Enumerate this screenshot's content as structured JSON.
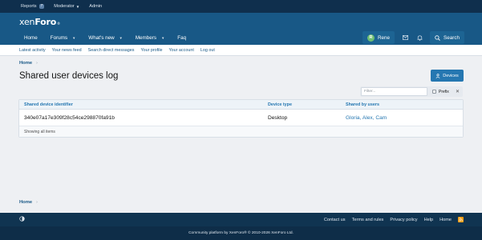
{
  "staffbar": {
    "reports_label": "Reports",
    "reports_count": "7",
    "moderator_label": "Moderator",
    "admin_label": "Admin"
  },
  "brand": {
    "logo_part1": "xen",
    "logo_part2": "Foro"
  },
  "nav": {
    "items": [
      {
        "label": "Home"
      },
      {
        "label": "Forums"
      },
      {
        "label": "What's new"
      },
      {
        "label": "Members"
      },
      {
        "label": "Faq"
      }
    ],
    "user_initial": "R",
    "user_name": "Rene",
    "search_label": "Search"
  },
  "subnav": [
    "Latest activity",
    "Your news feed",
    "Search direct messages",
    "Your profile",
    "Your account",
    "Log out"
  ],
  "breadcrumb": {
    "home": "Home"
  },
  "page": {
    "title": "Shared user devices log",
    "devices_button": "Devices"
  },
  "filter": {
    "placeholder": "Filter...",
    "prefix_label": "Prefix"
  },
  "table": {
    "headers": [
      "Shared device identifier",
      "Device type",
      "Shared by users"
    ],
    "rows": [
      {
        "identifier": "340e07a17e309f28c54ce298870fa91b",
        "device_type": "Desktop",
        "users": "Gloria, Alex, Cam"
      }
    ],
    "footer": "Showing all items"
  },
  "footer": {
    "links": [
      "Contact us",
      "Terms and rules",
      "Privacy policy",
      "Help",
      "Home"
    ],
    "copyright": "Community platform by XenForo® © 2010-2026 XenForo Ltd."
  },
  "colors": {
    "primary": "#185886",
    "accent": "#2577b1",
    "footer_bg": "#103451"
  }
}
